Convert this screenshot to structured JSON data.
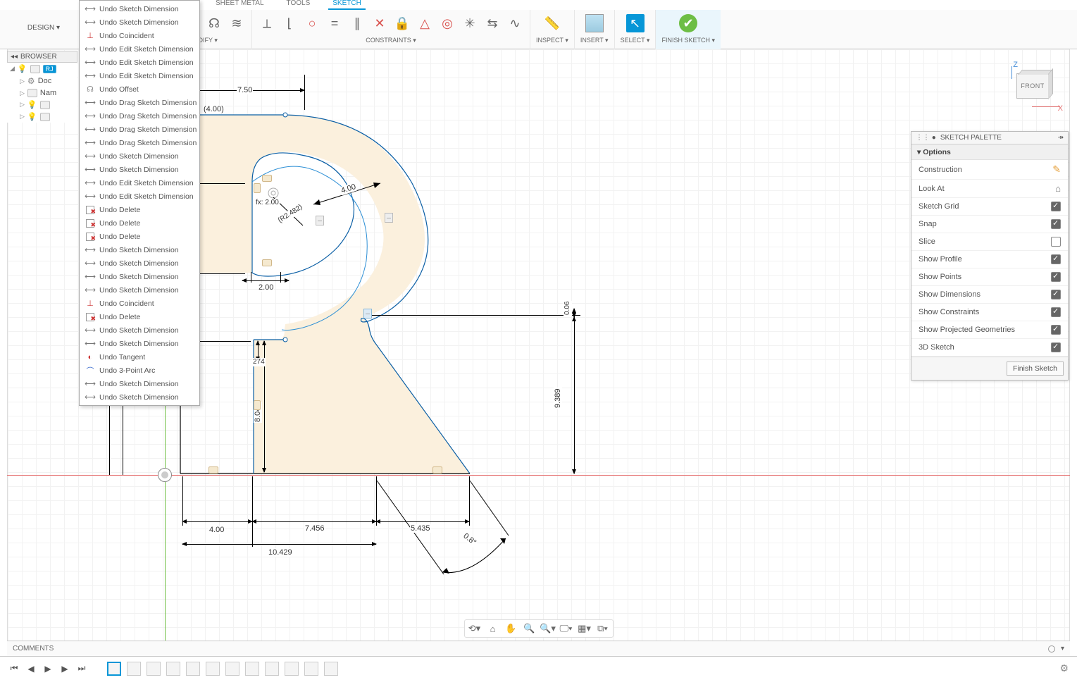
{
  "tabs": {
    "sheet_metal": "SHEET METAL",
    "tools": "TOOLS",
    "sketch": "SKETCH"
  },
  "design_btn": "DESIGN ▾",
  "toolbar_groups": {
    "modify": "MODIFY ▾",
    "constraints": "CONSTRAINTS ▾",
    "inspect": "INSPECT ▾",
    "insert": "INSERT ▾",
    "select": "SELECT ▾",
    "finish": "FINISH SKETCH ▾"
  },
  "browser": {
    "title": "BROWSER",
    "items": [
      {
        "code": "RJ"
      },
      {
        "label": "Doc"
      },
      {
        "label": "Nam"
      }
    ]
  },
  "undo_menu": [
    {
      "ico": "dim",
      "label": "Undo Sketch Dimension"
    },
    {
      "ico": "dim",
      "label": "Undo Sketch Dimension"
    },
    {
      "ico": "coin",
      "label": "Undo Coincident"
    },
    {
      "ico": "dim",
      "label": "Undo Edit Sketch Dimension"
    },
    {
      "ico": "dim",
      "label": "Undo Edit Sketch Dimension"
    },
    {
      "ico": "dim",
      "label": "Undo Edit Sketch Dimension"
    },
    {
      "ico": "off",
      "label": "Undo Offset"
    },
    {
      "ico": "dim",
      "label": "Undo Drag Sketch Dimension"
    },
    {
      "ico": "dim",
      "label": "Undo Drag Sketch Dimension"
    },
    {
      "ico": "dim",
      "label": "Undo Drag Sketch Dimension"
    },
    {
      "ico": "dim",
      "label": "Undo Drag Sketch Dimension"
    },
    {
      "ico": "dim",
      "label": "Undo Sketch Dimension"
    },
    {
      "ico": "dim",
      "label": "Undo Sketch Dimension"
    },
    {
      "ico": "dim",
      "label": "Undo Edit Sketch Dimension"
    },
    {
      "ico": "dim",
      "label": "Undo Edit Sketch Dimension"
    },
    {
      "ico": "del",
      "label": "Undo Delete"
    },
    {
      "ico": "del",
      "label": "Undo Delete"
    },
    {
      "ico": "del",
      "label": "Undo Delete"
    },
    {
      "ico": "dim",
      "label": "Undo Sketch Dimension"
    },
    {
      "ico": "dim",
      "label": "Undo Sketch Dimension"
    },
    {
      "ico": "dim",
      "label": "Undo Sketch Dimension"
    },
    {
      "ico": "dim",
      "label": "Undo Sketch Dimension"
    },
    {
      "ico": "coin",
      "label": "Undo Coincident"
    },
    {
      "ico": "del",
      "label": "Undo Delete"
    },
    {
      "ico": "dim",
      "label": "Undo Sketch Dimension"
    },
    {
      "ico": "dim",
      "label": "Undo Sketch Dimension"
    },
    {
      "ico": "tan",
      "label": "Undo Tangent"
    },
    {
      "ico": "arc",
      "label": "Undo 3-Point Arc"
    },
    {
      "ico": "dim",
      "label": "Undo Sketch Dimension"
    },
    {
      "ico": "dim",
      "label": "Undo Sketch Dimension"
    }
  ],
  "dims": {
    "d7_50": "7.50",
    "d4_00_paren": "(4.00)",
    "fx2": "fx: 2.00",
    "r2_482": "(R2.482)",
    "d4_00r": "4.00",
    "d2_00": "2.00",
    "d274": "274",
    "d8_042": "8.042",
    "d4_00b": "4.00",
    "d7_456": "7.456",
    "d5_435": "5.435",
    "d10_429": "10.429",
    "d0_8": "0.8°",
    "d9_389": "9.389",
    "d0_06": "0.06"
  },
  "viewcube": {
    "face": "FRONT",
    "z": "Z",
    "x": "X"
  },
  "palette": {
    "title": "SKETCH PALETTE",
    "section": "Options",
    "rows": [
      {
        "label": "Construction",
        "type": "icon"
      },
      {
        "label": "Look At",
        "type": "icon2"
      },
      {
        "label": "Sketch Grid",
        "checked": true
      },
      {
        "label": "Snap",
        "checked": true
      },
      {
        "label": "Slice",
        "checked": false
      },
      {
        "label": "Show Profile",
        "checked": true
      },
      {
        "label": "Show Points",
        "checked": true
      },
      {
        "label": "Show Dimensions",
        "checked": true
      },
      {
        "label": "Show Constraints",
        "checked": true
      },
      {
        "label": "Show Projected Geometries",
        "checked": true
      },
      {
        "label": "3D Sketch",
        "checked": true
      }
    ],
    "finish_btn": "Finish Sketch"
  },
  "comments_label": "COMMENTS"
}
